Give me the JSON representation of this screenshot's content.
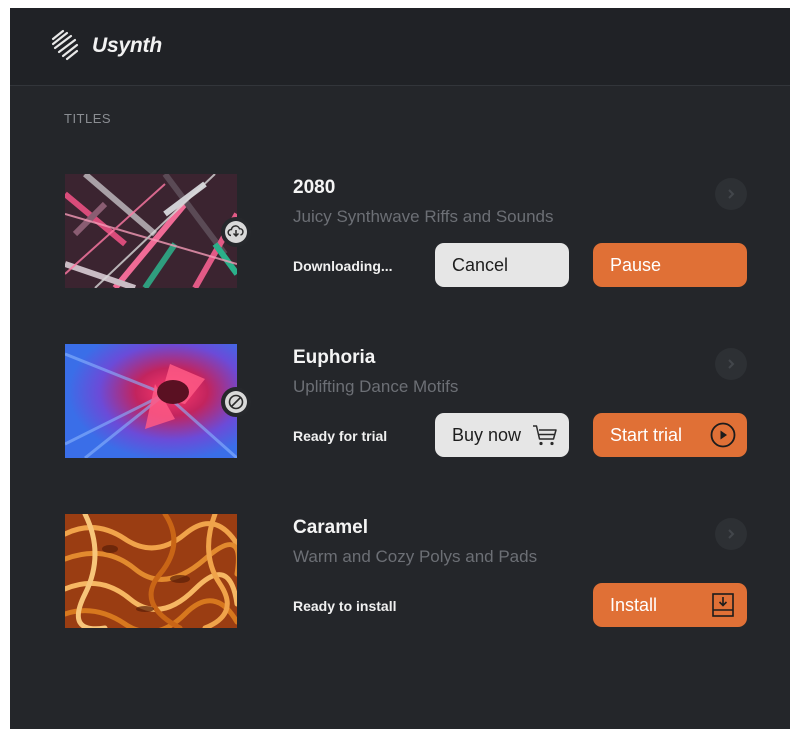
{
  "header": {
    "brand": "Usynth",
    "logo_icon": "usynth-logo-icon"
  },
  "section": {
    "label": "TITLES"
  },
  "colors": {
    "accent": "#e07036",
    "background": "#24262a",
    "header": "#202226"
  },
  "items": [
    {
      "title": "2080",
      "subtitle": "Juicy Synthwave Riffs and Sounds",
      "status": "Downloading...",
      "secondary_label": "Cancel",
      "primary_label": "Pause",
      "badge_icon": "download-cloud-icon"
    },
    {
      "title": "Euphoria",
      "subtitle": "Uplifting Dance Motifs",
      "status": "Ready for trial",
      "secondary_label": "Buy now",
      "secondary_icon": "cart-icon",
      "primary_label": "Start trial",
      "primary_icon": "play-circle-icon",
      "badge_icon": "blocked-icon"
    },
    {
      "title": "Caramel",
      "subtitle": "Warm and Cozy Polys and Pads",
      "status": "Ready to install",
      "primary_label": "Install",
      "primary_icon": "install-download-icon"
    }
  ]
}
